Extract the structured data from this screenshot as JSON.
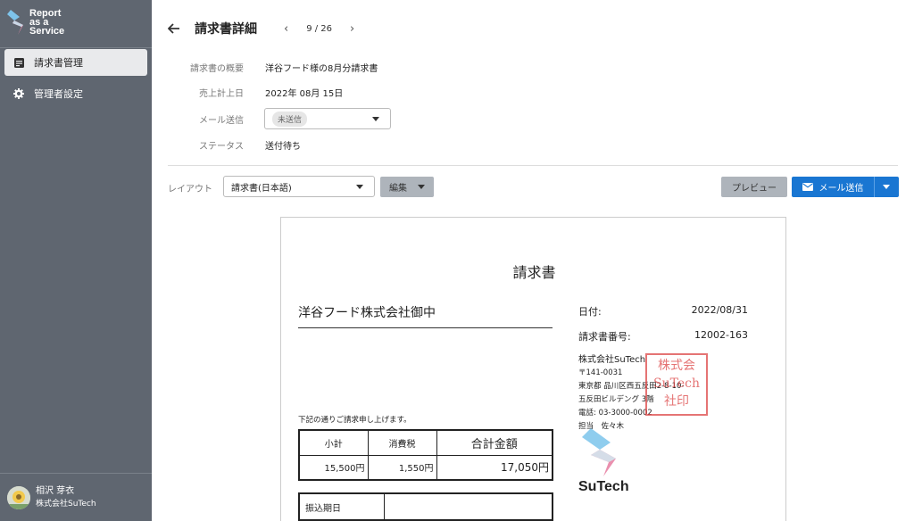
{
  "app": {
    "logo_lines": [
      "Report",
      "as a",
      "Service"
    ]
  },
  "sidebar": {
    "items": [
      {
        "label": "請求書管理",
        "icon": "invoice-icon",
        "active": true
      },
      {
        "label": "管理者設定",
        "icon": "gear-icon",
        "active": false
      }
    ],
    "user": {
      "name": "相沢 芽衣",
      "company": "株式会社SuTech"
    }
  },
  "header": {
    "title": "請求書詳細",
    "pager": "9 / 26"
  },
  "details": {
    "summary_label": "請求書の概要",
    "summary_value": "洋谷フード様の8月分請求書",
    "date_label": "売上計上日",
    "date_value": "2022年 08月 15日",
    "mail_label": "メール送信",
    "mail_value": "未送信",
    "status_label": "ステータス",
    "status_value": "送付待ち",
    "status_color": "#e88a2e"
  },
  "toolbar": {
    "layout_label": "レイアウト",
    "layout_value": "請求書(日本語)",
    "edit_label": "編集",
    "preview_label": "プレビュー",
    "mail_button_label": "メール送信",
    "accent_color": "#1976d2"
  },
  "invoice": {
    "title": "請求書",
    "client": "洋谷フード株式会社御中",
    "date_label": "日付:",
    "date_value": "2022/08/31",
    "number_label": "請求書番号:",
    "number_value": "12002-163",
    "company_name": "株式会社SuTech",
    "postal": "〒141-0031",
    "address1": "東京都 品川区西五反田2-8-10-",
    "address2": "五反田ビルデング 3階",
    "phone": "電話: 03-3000-0002",
    "person": "担当　佐々木",
    "seal_text": "株式会社SuTech印",
    "logo_name": "SuTech",
    "note": "下記の通りご請求申し上げます。",
    "headers": [
      "小計",
      "消費税",
      "合計金額"
    ],
    "values": [
      "15,500円",
      "1,550円",
      "17,050円"
    ],
    "due_label": "振込期日",
    "due_value": ""
  }
}
